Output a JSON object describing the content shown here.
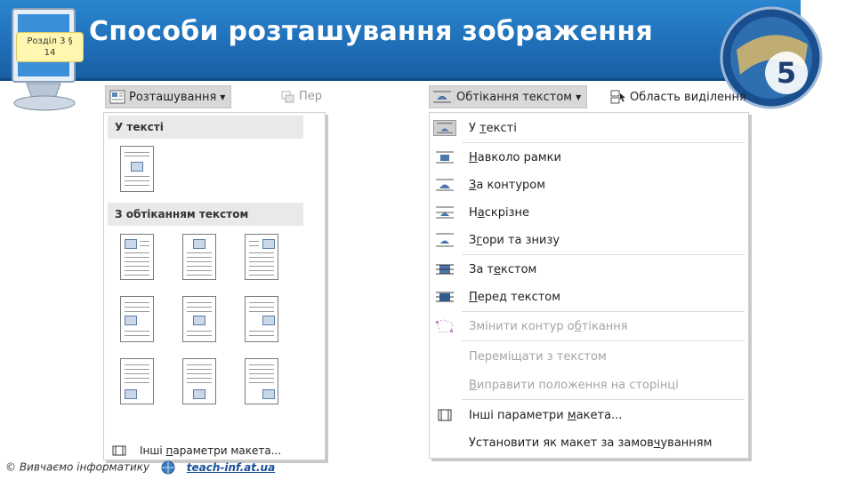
{
  "slide": {
    "title": "Способи розташування зображення",
    "section_line1": "Розділ 3 §",
    "section_line2": "14",
    "logo_number": "5"
  },
  "footer": {
    "copyright": "© Вивчаємо інформатику",
    "link": "teach-inf.at.ua"
  },
  "position_menu": {
    "button_label": "Розташування",
    "ghost_label": "Пер",
    "section_inline": "У тексті",
    "section_wrap": "З обтіканням текстом",
    "more_label_pre": "Інші ",
    "more_label_u": "п",
    "more_label_post": "араметри макета..."
  },
  "wrap_menu": {
    "button_label": "Обтікання текстом",
    "area_label": "Область виділення",
    "items": [
      {
        "pre": "У ",
        "u": "т",
        "post": "ексті"
      },
      {
        "pre": "",
        "u": "Н",
        "post": "авколо рамки"
      },
      {
        "pre": "",
        "u": "З",
        "post": "а контуром"
      },
      {
        "pre": "Н",
        "u": "а",
        "post": "скрізне"
      },
      {
        "pre": "З",
        "u": "г",
        "post": "ори та знизу"
      },
      {
        "pre": "За т",
        "u": "е",
        "post": "кстом"
      },
      {
        "pre": "",
        "u": "П",
        "post": "еред текстом"
      },
      {
        "pre": "Змінити контур о",
        "u": "б",
        "post": "тікання"
      },
      {
        "pre": "Переміщати з текстом",
        "u": "",
        "post": ""
      },
      {
        "pre": "",
        "u": "В",
        "post": "иправити положення на сторінці"
      },
      {
        "pre": "Інші параметри ",
        "u": "м",
        "post": "акета..."
      },
      {
        "pre": "Установити як макет за замов",
        "u": "ч",
        "post": "уванням"
      }
    ]
  },
  "colors": {
    "header_blue": "#1f6db6",
    "accent_green": "#2e9b54"
  }
}
